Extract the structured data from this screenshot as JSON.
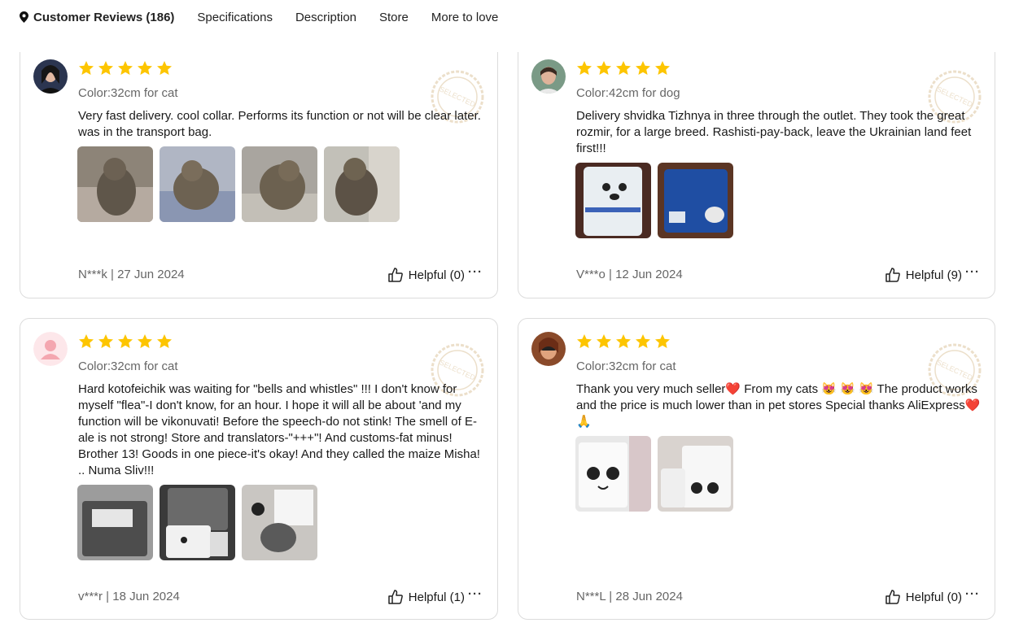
{
  "tabs": [
    {
      "label": "Customer Reviews (186)",
      "active": true
    },
    {
      "label": "Specifications"
    },
    {
      "label": "Description"
    },
    {
      "label": "Store"
    },
    {
      "label": "More to love"
    }
  ],
  "stamp_text": "SELECTED",
  "reviews": [
    {
      "color": "Color:32cm for cat",
      "text": "Very fast delivery. cool collar. Performs its function or not will be clear later. was in the transport bag.",
      "author_date": "N***k | 27 Jun 2024",
      "helpful": "Helpful (0)",
      "stars": 5,
      "photo_count": 4
    },
    {
      "color": "Color:42cm for dog",
      "text": "Delivery shvidka Tizhnya in three through the outlet. They took the great rozmir, for a large breed. Rashisti-pay-back, leave the Ukrainian land feet first!!!",
      "author_date": "V***o | 12 Jun 2024",
      "helpful": "Helpful (9)",
      "stars": 5,
      "photo_count": 2
    },
    {
      "color": "Color:32cm for cat",
      "text": "Hard kotofeichik was waiting for \"bells and whistles\" !!! I don't know for myself \"flea\"-I don't know, for an hour. I hope it will all be about 'and my function will be vikonuvati! Before the speech-do not stink! The smell of E-ale is not strong! Store and translators-\"+++\"! And customs-fat minus! Brother 13! Goods in one piece-it's okay! And they called the maize Misha! .. Numa Sliv!!!",
      "author_date": "v***r | 18 Jun 2024",
      "helpful": "Helpful (1)",
      "stars": 5,
      "photo_count": 3
    },
    {
      "color": "Color:32cm for cat",
      "text_parts": [
        "Thank you very much seller",
        "❤️",
        " From my cats",
        "😻 😻 😻",
        " The product works and the price is much lower than in pet stores Special thanks AliExpress",
        "❤️",
        "🙏"
      ],
      "author_date": "N***L | 28 Jun 2024",
      "helpful": "Helpful (0)",
      "stars": 5,
      "photo_count": 2
    }
  ]
}
